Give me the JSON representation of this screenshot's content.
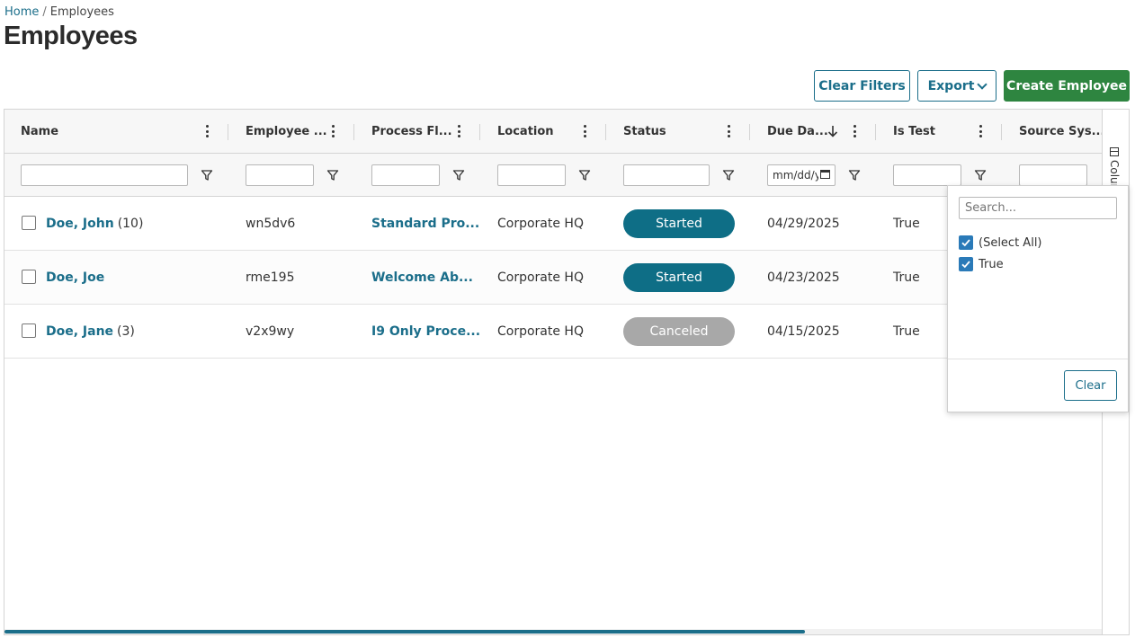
{
  "breadcrumb": {
    "home": "Home",
    "separator": "/",
    "current": "Employees"
  },
  "page": {
    "title": "Employees"
  },
  "toolbar": {
    "clear_filters": "Clear Filters",
    "export": "Export",
    "create_employee": "Create Employee"
  },
  "grid": {
    "columns": [
      {
        "label": "Name"
      },
      {
        "label": "Employee ..."
      },
      {
        "label": "Process Fl..."
      },
      {
        "label": "Location"
      },
      {
        "label": "Status"
      },
      {
        "label": "Due Da..."
      },
      {
        "label": "Is Test"
      },
      {
        "label": "Source Sys..."
      }
    ],
    "sort": {
      "column": "Due Da...",
      "direction": "descending"
    },
    "date_filter_placeholder": "mm/dd/yyyy",
    "rows": [
      {
        "name": "Doe, John",
        "count": "(10)",
        "employee_id": "wn5dv6",
        "process_flow": "Standard Pro...",
        "location": "Corporate HQ",
        "status": "Started",
        "due_date": "04/29/2025",
        "is_test": "True"
      },
      {
        "name": "Doe, Joe",
        "count": "",
        "employee_id": "rme195",
        "process_flow": "Welcome Ab...",
        "location": "Corporate HQ",
        "status": "Started",
        "due_date": "04/23/2025",
        "is_test": "True"
      },
      {
        "name": "Doe, Jane",
        "count": "(3)",
        "employee_id": "v2x9wy",
        "process_flow": "I9 Only Proce...",
        "location": "Corporate HQ",
        "status": "Canceled",
        "due_date": "04/15/2025",
        "is_test": "True"
      }
    ],
    "status_colors": {
      "Started": "#0e6e86",
      "Canceled": "#a8a8a8"
    },
    "side_panel": {
      "label": "Columns"
    }
  },
  "filter_popup": {
    "search_placeholder": "Search...",
    "options": [
      {
        "label": "(Select All)",
        "checked": true
      },
      {
        "label": "True",
        "checked": true
      }
    ],
    "clear": "Clear"
  },
  "colors": {
    "link": "#1b6e8a",
    "primary": "#2e8540",
    "checkbox": "#2a7ab8"
  }
}
